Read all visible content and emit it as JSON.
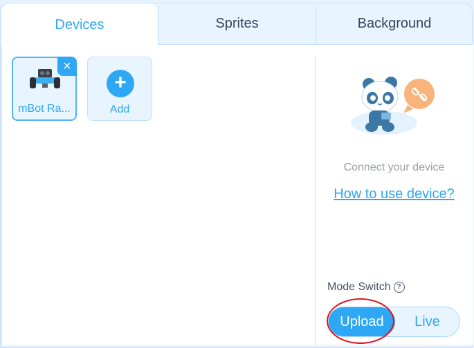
{
  "tabs": [
    {
      "label": "Devices",
      "active": true
    },
    {
      "label": "Sprites",
      "active": false
    },
    {
      "label": "Background",
      "active": false
    }
  ],
  "devices": [
    {
      "label": "mBot Ra...",
      "icon": "robot-car-icon",
      "selected": true,
      "close_icon": "×"
    }
  ],
  "add_card": {
    "label": "Add",
    "icon": "+"
  },
  "connect_panel": {
    "illustration": "panda-disconnected-illustration",
    "status_text": "Connect your device",
    "help_link": "How to use device?"
  },
  "mode_switch": {
    "label": "Mode Switch",
    "help_icon": "?",
    "options": [
      "Upload",
      "Live"
    ],
    "selected": "Upload"
  },
  "colors": {
    "accent": "#2ea7f4",
    "highlight": "#e0141e",
    "border": "#c6e1fb"
  }
}
